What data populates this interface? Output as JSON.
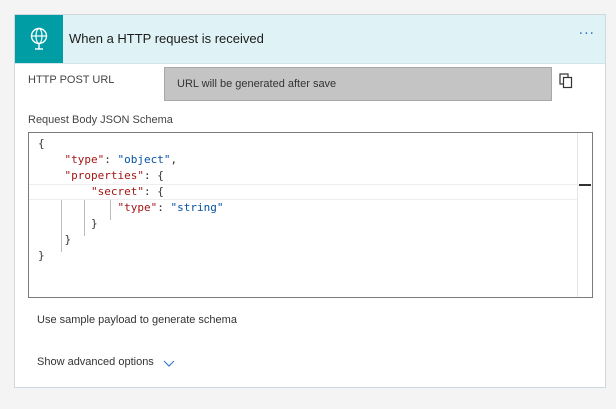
{
  "header": {
    "title": "When a HTTP request is received",
    "more_label": "···",
    "icon": "globe-request-icon",
    "accent": "#009da5",
    "background": "#dff3f6"
  },
  "url_section": {
    "label": "HTTP POST URL",
    "value": "URL will be generated after save",
    "copy_icon": "copy-icon"
  },
  "schema_section": {
    "label": "Request Body JSON Schema",
    "lines": [
      [
        {
          "t": "{",
          "c": "p"
        }
      ],
      [
        {
          "t": "    ",
          "c": "p"
        },
        {
          "t": "\"type\"",
          "c": "k"
        },
        {
          "t": ": ",
          "c": "p"
        },
        {
          "t": "\"object\"",
          "c": "s"
        },
        {
          "t": ",",
          "c": "p"
        }
      ],
      [
        {
          "t": "    ",
          "c": "p"
        },
        {
          "t": "\"properties\"",
          "c": "k"
        },
        {
          "t": ": {",
          "c": "p"
        }
      ],
      [
        {
          "t": "        ",
          "c": "p"
        },
        {
          "t": "\"secret\"",
          "c": "k"
        },
        {
          "t": ": {",
          "c": "p"
        }
      ],
      [
        {
          "t": "            ",
          "c": "p"
        },
        {
          "t": "\"type\"",
          "c": "k"
        },
        {
          "t": ": ",
          "c": "p"
        },
        {
          "t": "\"string\"",
          "c": "s"
        }
      ],
      [
        {
          "t": "        }",
          "c": "p"
        }
      ],
      [
        {
          "t": "    }",
          "c": "p"
        }
      ],
      [
        {
          "t": "}",
          "c": "p"
        }
      ]
    ]
  },
  "sample_payload_link": "Use sample payload to generate schema",
  "advanced_options": {
    "label": "Show advanced options",
    "icon": "chevron-down-icon"
  }
}
